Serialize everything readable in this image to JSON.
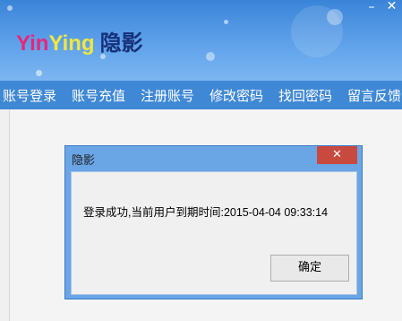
{
  "app": {
    "logo_part1": "Yin",
    "logo_part2": "Ying",
    "logo_chinese": "隐影"
  },
  "window_controls": {
    "minimize": "–",
    "close": "✕"
  },
  "menu": {
    "items": [
      {
        "label": "账号登录"
      },
      {
        "label": "账号充值"
      },
      {
        "label": "注册账号"
      },
      {
        "label": "修改密码"
      },
      {
        "label": "找回密码"
      },
      {
        "label": "留言反馈"
      }
    ]
  },
  "dialog": {
    "title": "隐影",
    "close_glyph": "✕",
    "message": "登录成功,当前用户到期时间:2015-04-04 09:33:14",
    "ok_label": "确定"
  },
  "colors": {
    "header_blue": "#3a84d8",
    "menu_blue": "#3f88d6",
    "logo_pink": "#e8267a",
    "logo_yellow": "#f2e640",
    "logo_navy": "#17307a",
    "dialog_close_red": "#c84a3e"
  }
}
